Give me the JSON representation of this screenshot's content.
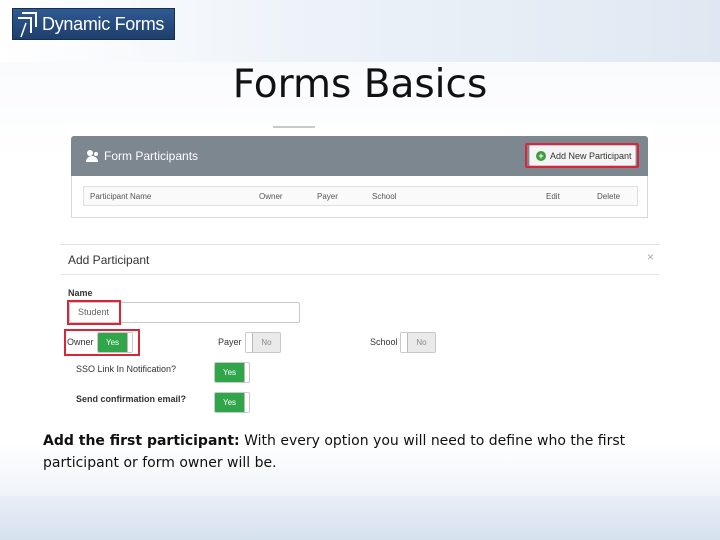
{
  "logo": {
    "text": "Dynamic Forms"
  },
  "slide_title": "Forms Basics",
  "participants_panel": {
    "title": "Form Participants",
    "add_button_label": "Add New Participant",
    "columns": [
      "Participant Name",
      "Owner",
      "Payer",
      "School",
      "Edit",
      "Delete"
    ]
  },
  "add_participant": {
    "title": "Add Participant",
    "close_glyph": "×",
    "name_label": "Name",
    "name_value": "Student",
    "owner_label": "Owner",
    "owner_value": "Yes",
    "payer_label": "Payer",
    "payer_value": "No",
    "school_label": "School",
    "school_value": "No",
    "sso_label": "SSO Link In Notification?",
    "sso_value": "Yes",
    "confirm_label": "Send confirmation email?",
    "confirm_value": "Yes"
  },
  "caption": {
    "bold": "Add the first participant:",
    "text": "With every option you will need to define who the first participant or form owner will be."
  },
  "colors": {
    "header_gray": "#7d8790",
    "toggle_green": "#31a54a",
    "highlight_red": "#d9253a",
    "logo_blue": "#2f5a93"
  }
}
